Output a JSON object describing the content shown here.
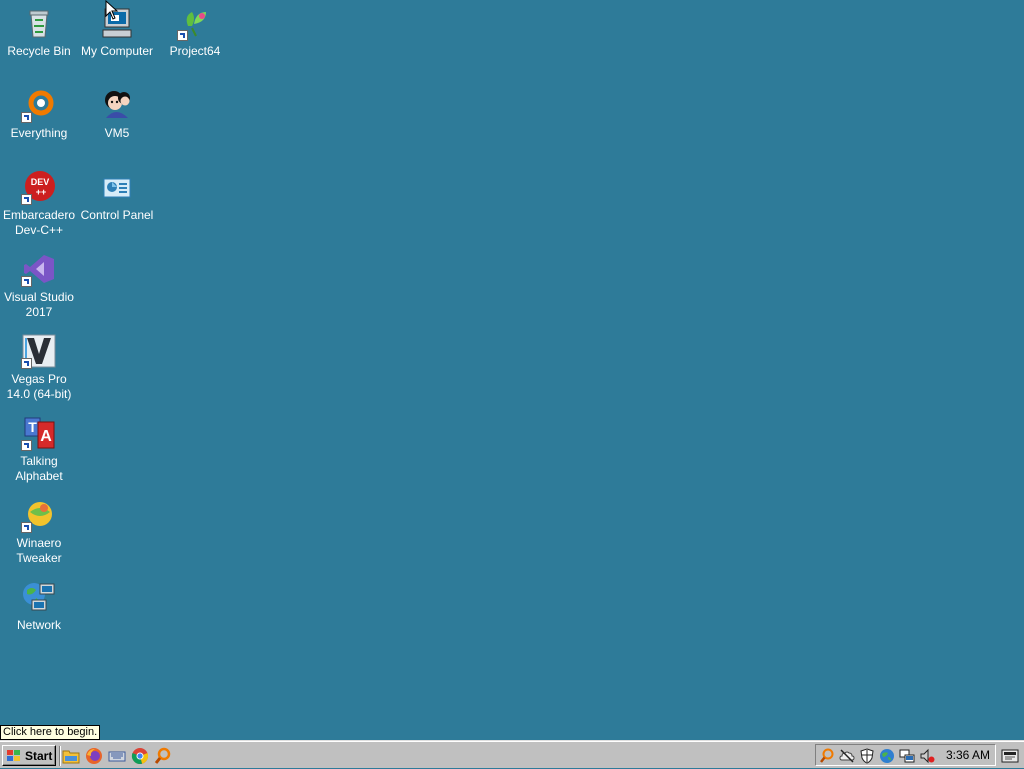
{
  "desktop": {
    "background_color": "#2e7b99",
    "icons": [
      {
        "label": "Recycle Bin",
        "icon": "recycle-bin-icon"
      },
      {
        "label": "My Computer",
        "icon": "my-computer-icon"
      },
      {
        "label": "Project64",
        "icon": "project64-icon"
      },
      {
        "label": "Everything",
        "icon": "everything-icon"
      },
      {
        "label": "VM5",
        "icon": "vm5-icon"
      },
      {
        "label": "Embarcadero Dev-C++",
        "icon": "devcpp-icon"
      },
      {
        "label": "Control Panel",
        "icon": "control-panel-icon"
      },
      {
        "label": "Visual Studio 2017",
        "icon": "visual-studio-icon"
      },
      {
        "label": "Vegas Pro 14.0 (64-bit)",
        "icon": "vegas-pro-icon"
      },
      {
        "label": "Talking Alphabet",
        "icon": "talking-alphabet-icon"
      },
      {
        "label": "Winaero Tweaker",
        "icon": "winaero-tweaker-icon"
      },
      {
        "label": "Network",
        "icon": "network-icon"
      }
    ]
  },
  "tooltip": {
    "text": "Click here to begin."
  },
  "taskbar": {
    "start_label": "Start",
    "quick_launch": [
      "file-explorer-icon",
      "firefox-icon",
      "keyboard-icon",
      "chrome-icon",
      "search-icon"
    ],
    "tray": {
      "icons": [
        "search-icon",
        "cloud-icon",
        "shield-icon",
        "globe-icon",
        "network-icon",
        "volume-muted-icon"
      ],
      "clock": "3:36 AM"
    },
    "show_desktop_icon": "show-desktop-icon"
  }
}
